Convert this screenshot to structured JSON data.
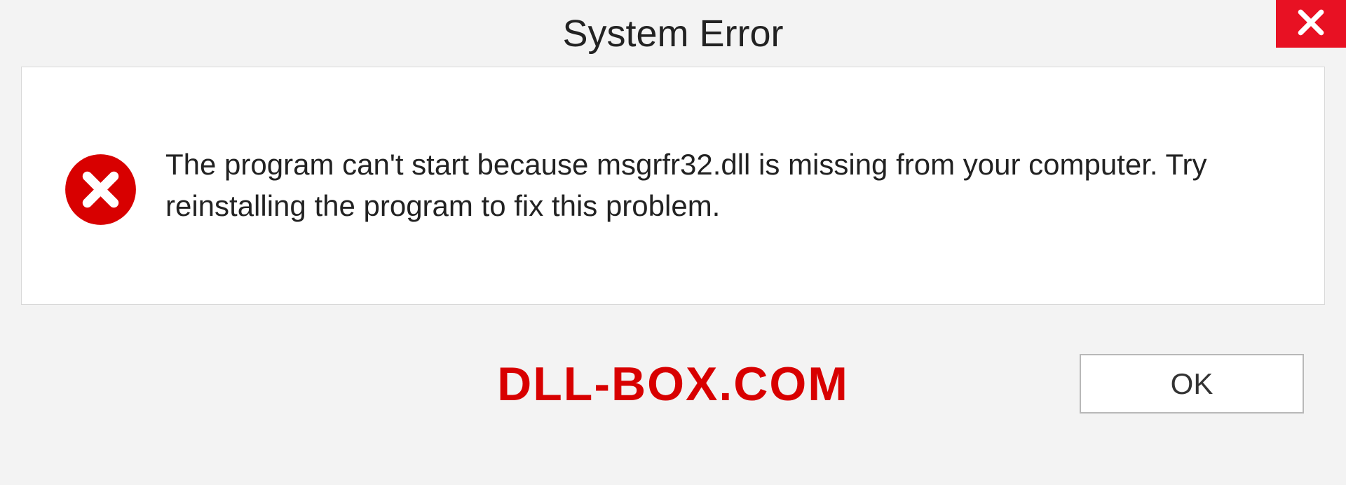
{
  "dialog": {
    "title": "System Error",
    "message": "The program can't start because msgrfr32.dll is missing from your computer. Try reinstalling the program to fix this problem.",
    "ok_label": "OK"
  },
  "watermark": "DLL-BOX.COM",
  "colors": {
    "close_bg": "#e81123",
    "error_red": "#d80000",
    "watermark_red": "#d80000"
  }
}
